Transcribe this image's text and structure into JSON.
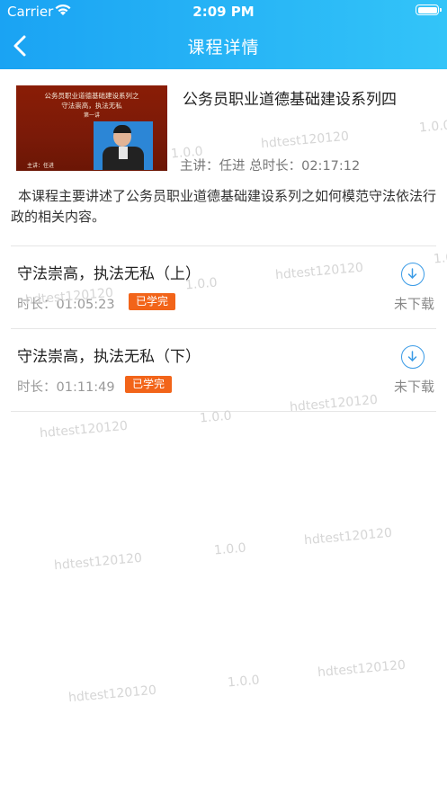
{
  "status": {
    "carrier": "Carrier",
    "time": "2:09 PM"
  },
  "nav": {
    "title": "课程详情"
  },
  "course": {
    "title": "公务员职业道德基础建设系列四",
    "thumbnail": {
      "line1": "公务员职业道德基础建设系列之",
      "line2": "守法崇高，执法无私",
      "line3": "第一讲",
      "line4": "主讲：任进"
    },
    "meta": "主讲：任进  总时长：02:17:12",
    "description": "本课程主要讲述了公务员职业道德基础建设系列之如何模范守法依法行政的相关内容。"
  },
  "lessons": [
    {
      "title": "守法崇高，执法无私（上）",
      "duration": "时长：01:05:23",
      "badge": "已学完",
      "download_label": "未下载"
    },
    {
      "title": "守法崇高，执法无私（下）",
      "duration": "时长：01:11:49",
      "badge": "已学完",
      "download_label": "未下载"
    }
  ],
  "watermark": {
    "user": "hdtest120120",
    "version": "1.0.0"
  },
  "colors": {
    "header_start": "#1aa3f3",
    "header_end": "#33c4f8",
    "badge": "#f26419",
    "icon": "#3a9be6"
  }
}
